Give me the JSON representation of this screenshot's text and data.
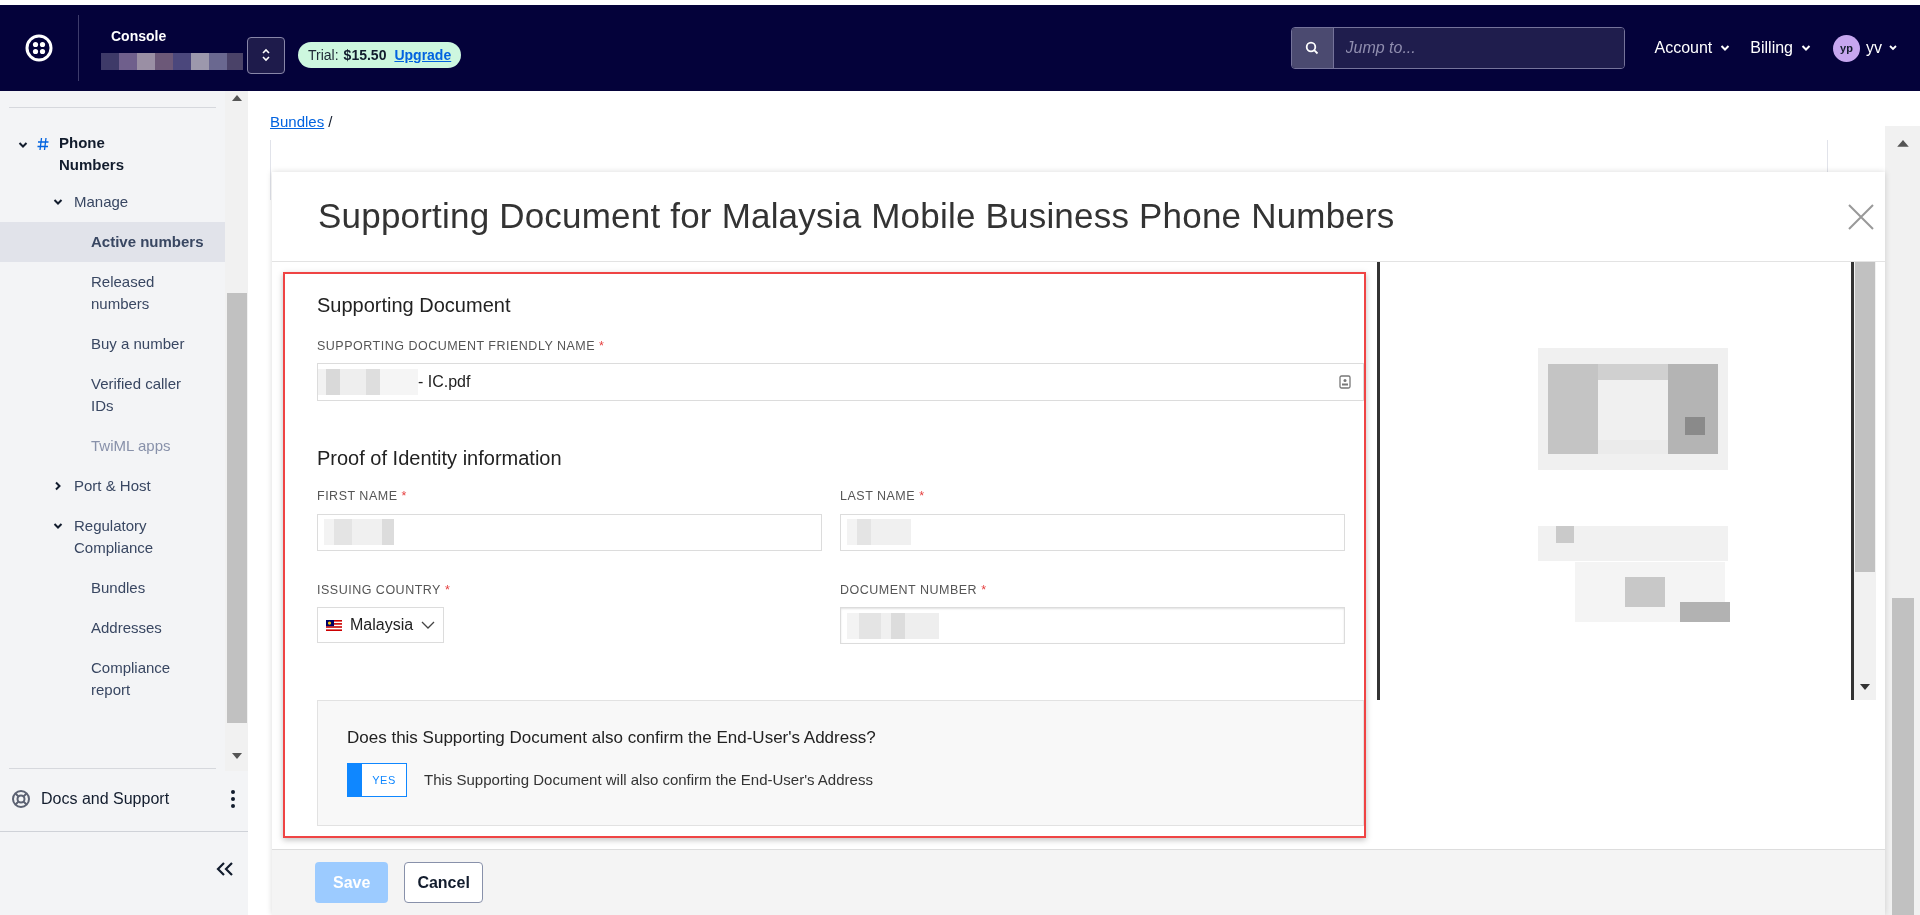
{
  "top_bar": {
    "product": "Console",
    "trial": {
      "label": "Trial:",
      "amount": "$15.50",
      "link": "Upgrade"
    },
    "search": {
      "placeholder": "Jump to..."
    },
    "menus": [
      "Account",
      "Billing"
    ],
    "avatar_initials": "yp",
    "user": "yv"
  },
  "sidebar": {
    "items": [
      {
        "label": "Phone Numbers",
        "expanded": true,
        "children": [
          {
            "label": "Manage",
            "expanded": true,
            "children": [
              {
                "label": "Active numbers",
                "selected": true,
                "disabled": false
              },
              {
                "label": "Released numbers",
                "selected": false,
                "disabled": false
              },
              {
                "label": "Buy a number",
                "selected": false,
                "disabled": false
              },
              {
                "label": "Verified caller IDs",
                "selected": false,
                "disabled": false
              },
              {
                "label": "TwiML apps",
                "selected": false,
                "disabled": true
              }
            ]
          },
          {
            "label": "Port & Host",
            "expanded": false
          },
          {
            "label": "Regulatory Compliance",
            "expanded": true,
            "children": [
              {
                "label": "Bundles",
                "selected": false,
                "disabled": false
              },
              {
                "label": "Addresses",
                "selected": false,
                "disabled": false
              },
              {
                "label": "Compliance report",
                "selected": false,
                "disabled": false
              }
            ]
          }
        ]
      }
    ],
    "footer_link": "Docs and Support"
  },
  "breadcrumb": {
    "link": "Bundles",
    "separator": "/"
  },
  "modal": {
    "title": "Supporting Document for Malaysia Mobile Business Phone Numbers",
    "document_section": {
      "heading": "Supporting Document",
      "field": {
        "label": "SUPPORTING DOCUMENT FRIENDLY NAME",
        "required_mark": "*",
        "value": "- IC.pdf"
      }
    },
    "identity_section": {
      "heading": "Proof of Identity information",
      "fields": [
        {
          "kind": "text",
          "label": "FIRST NAME",
          "required_mark": "*"
        },
        {
          "kind": "text",
          "label": "LAST NAME",
          "required_mark": "*"
        },
        {
          "kind": "country",
          "label": "ISSUING COUNTRY",
          "required_mark": "*",
          "value": "Malaysia"
        },
        {
          "kind": "text",
          "label": "DOCUMENT NUMBER",
          "required_mark": "*"
        }
      ]
    },
    "address_box": {
      "question": "Does this Supporting Document also confirm the End-User's Address?",
      "toggle": {
        "label": "YES",
        "on": true
      },
      "description": "This Supporting Document will also confirm the End-User's Address"
    },
    "buttons": [
      {
        "label": "Save",
        "kind": "primary",
        "disabled": true
      },
      {
        "label": "Cancel",
        "kind": "secondary",
        "disabled": false
      }
    ]
  }
}
